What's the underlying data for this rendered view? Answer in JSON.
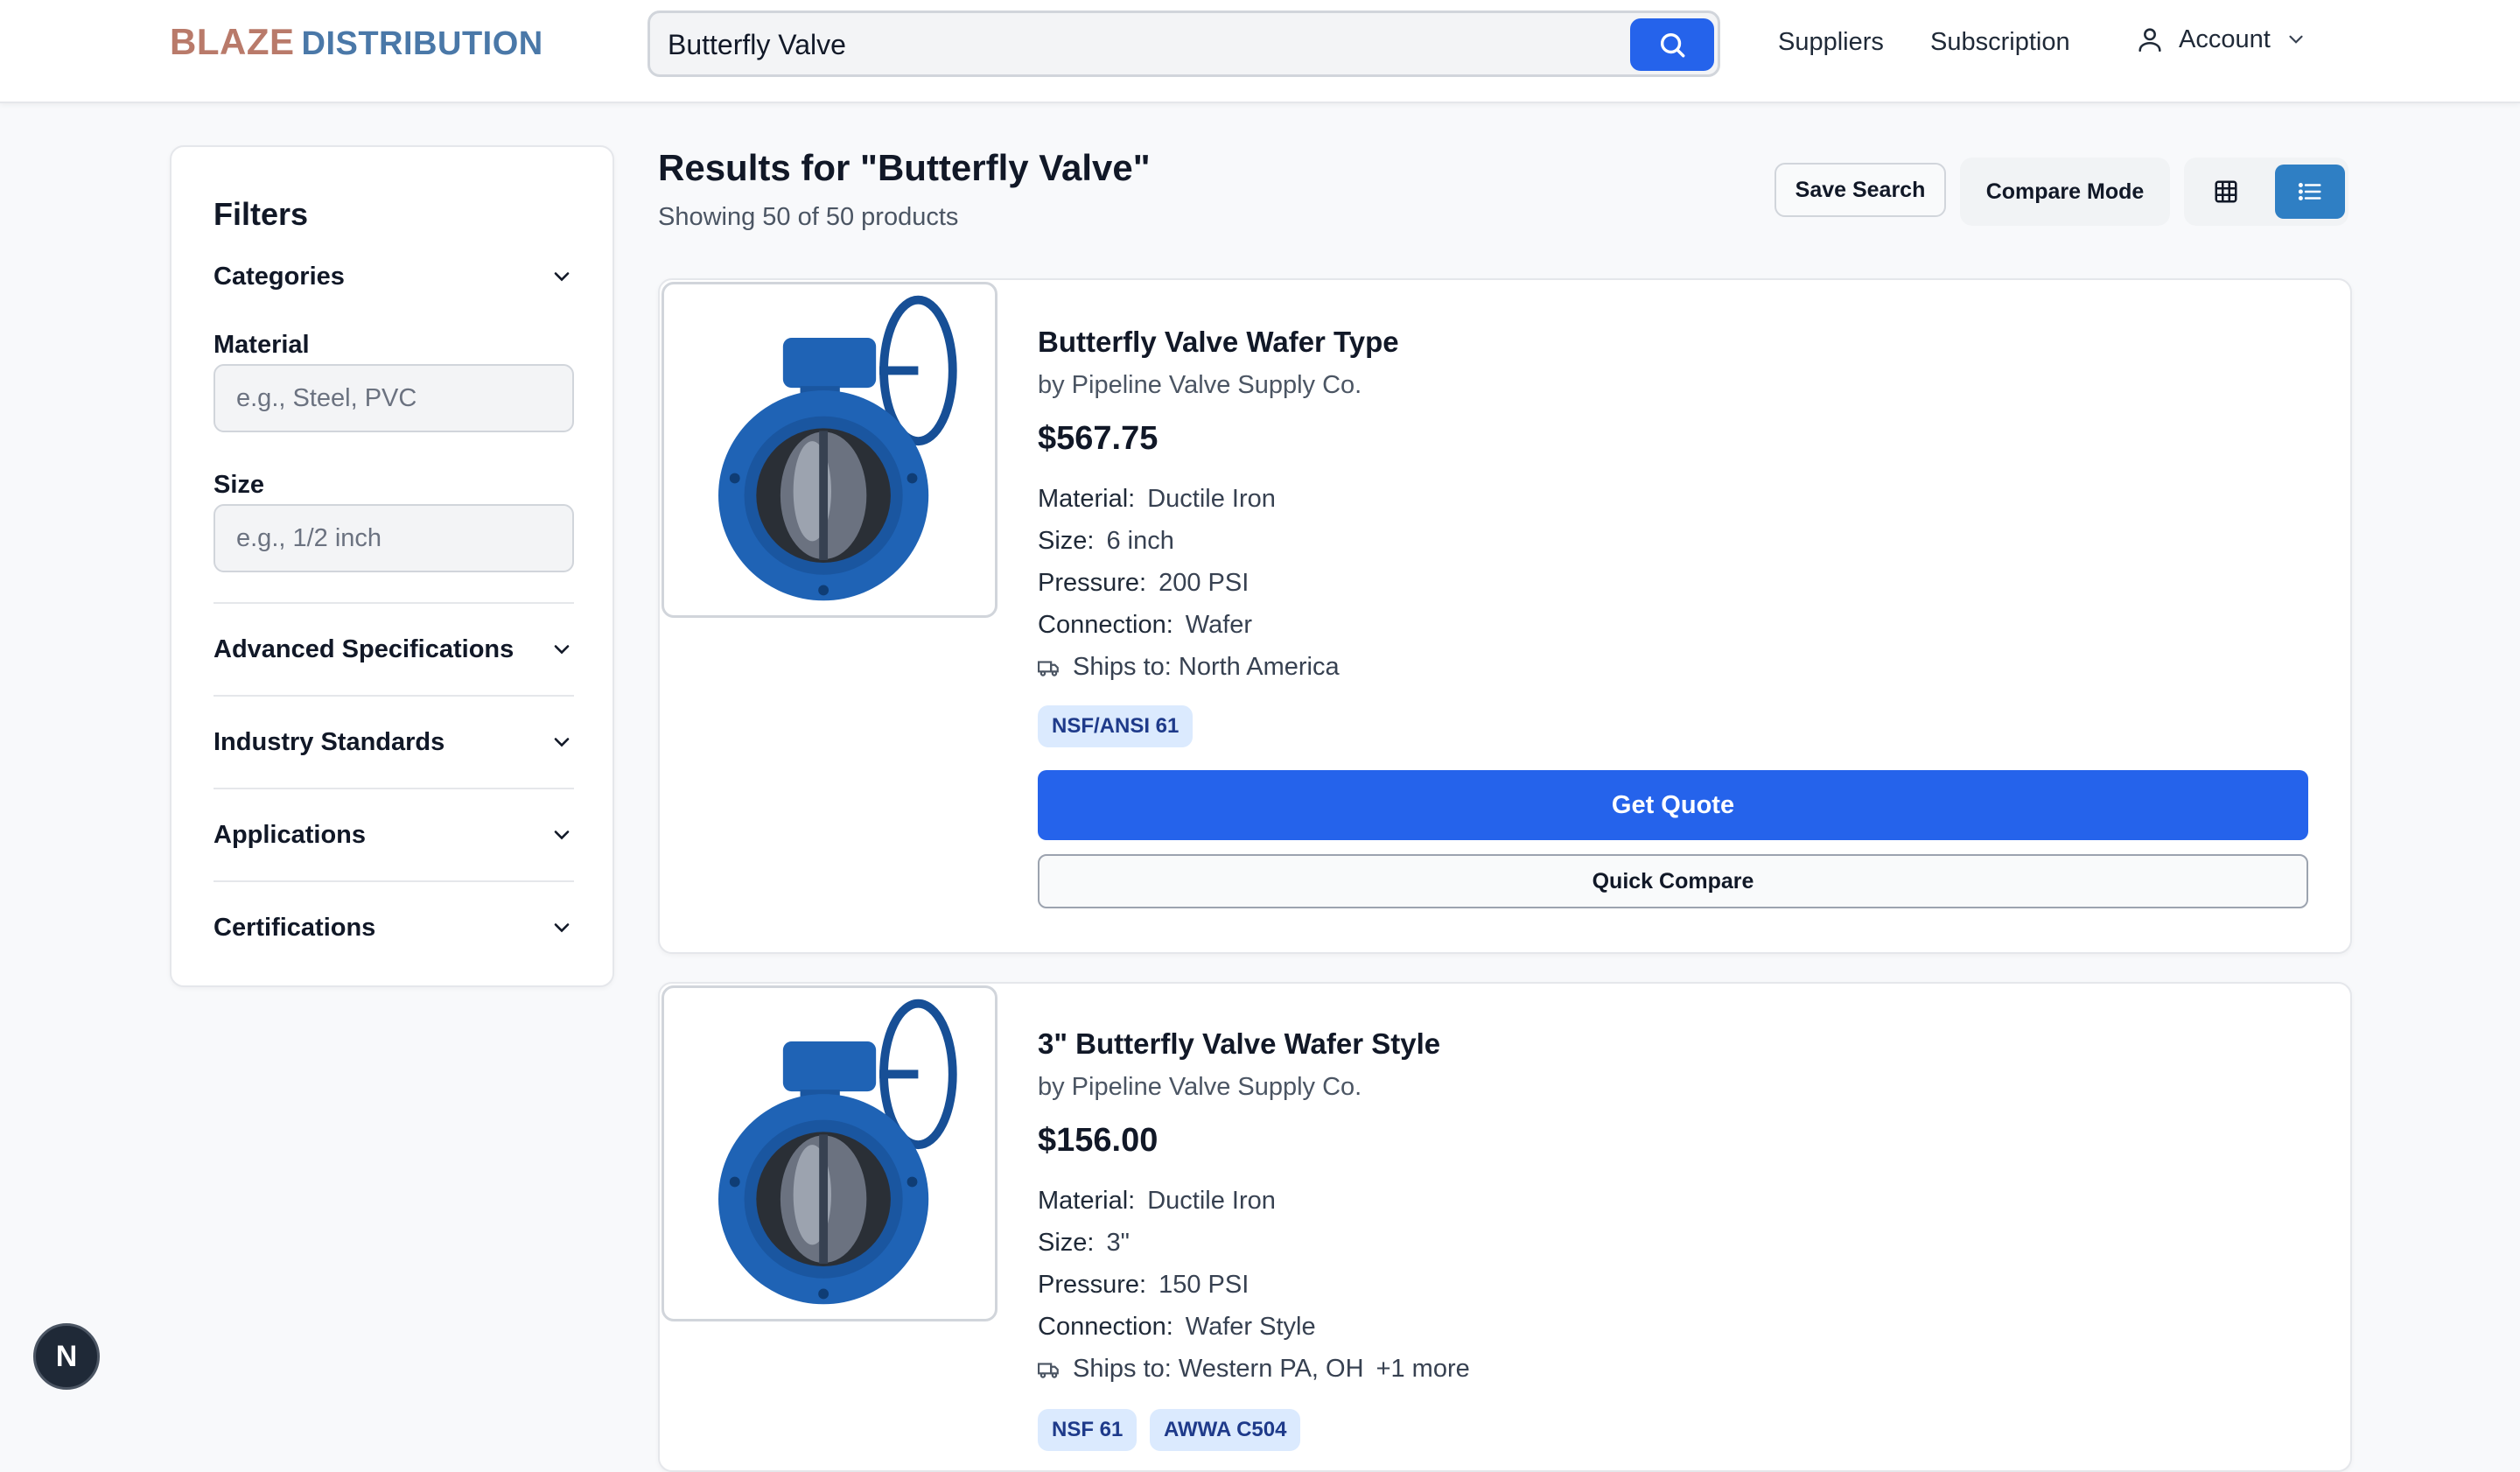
{
  "brand": {
    "part1": "BLAZE",
    "part2": "DISTRIBUTION"
  },
  "search": {
    "value": "Butterfly Valve",
    "placeholder": ""
  },
  "nav": {
    "suppliers": "Suppliers",
    "subscription": "Subscription",
    "account": "Account"
  },
  "sidebar": {
    "title": "Filters",
    "categories": "Categories",
    "material_label": "Material",
    "material_placeholder": "e.g., Steel, PVC",
    "size_label": "Size",
    "size_placeholder": "e.g., 1/2 inch",
    "sections": [
      "Advanced Specifications",
      "Industry Standards",
      "Applications",
      "Certifications"
    ]
  },
  "results": {
    "title": "Results for \"Butterfly Valve\"",
    "subtitle": "Showing 50 of 50 products",
    "save_search": "Save Search",
    "compare_mode": "Compare Mode"
  },
  "labels": {
    "material": "Material:",
    "size": "Size:",
    "pressure": "Pressure:",
    "connection": "Connection:",
    "get_quote": "Get Quote",
    "quick_compare": "Quick Compare"
  },
  "products": [
    {
      "name": "Butterfly Valve Wafer Type",
      "supplier": "by Pipeline Valve Supply Co.",
      "price": "$567.75",
      "material": "Ductile Iron",
      "size": "6 inch",
      "pressure": "200 PSI",
      "connection": "Wafer",
      "ships": "Ships to: North America",
      "tags": [
        "NSF/ANSI 61"
      ]
    },
    {
      "name": "3\" Butterfly Valve Wafer Style",
      "supplier": "by Pipeline Valve Supply Co.",
      "price": "$156.00",
      "material": "Ductile Iron",
      "size": "3\"",
      "pressure": "150 PSI",
      "connection": "Wafer Style",
      "ships": "Ships to: Western PA, OH",
      "ships_more": "+1 more",
      "tags": [
        "NSF 61",
        "AWWA C504"
      ]
    }
  ],
  "dev_badge": "N",
  "colors": {
    "primary": "#2563eb",
    "brand_red": "#b97a6a",
    "brand_blue": "#4a78a8",
    "valve_blue": "#1f63b5"
  }
}
